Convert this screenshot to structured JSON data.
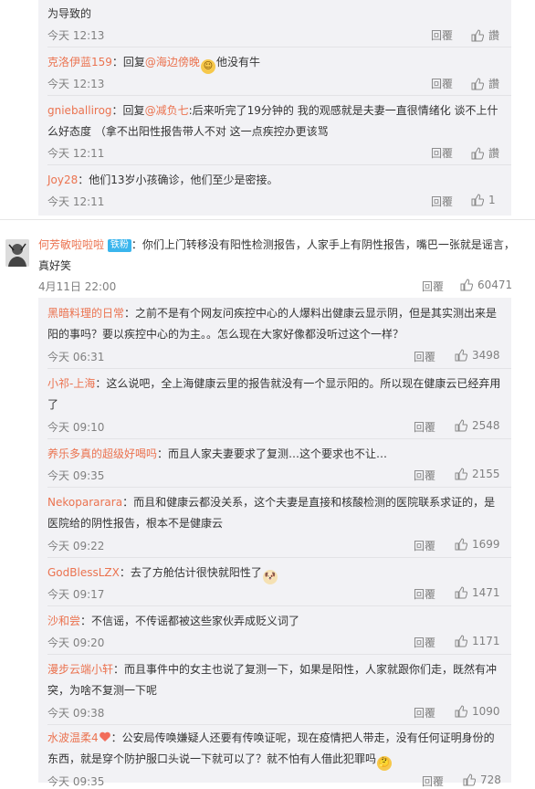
{
  "top_thread": [
    {
      "text_cont": "为导致的",
      "time": "今天 12:13",
      "reply": "回覆",
      "like": "讚"
    },
    {
      "user": "克洛伊蓝159",
      "colon": "：回复",
      "mention": "@海边傍晚",
      "emoji": "smiling-face-emoji",
      "text": "他没有牛",
      "time": "今天 12:13",
      "reply": "回覆",
      "like": "讚"
    },
    {
      "user": "gnieballirog",
      "colon": "：回复",
      "mention": "@减负七",
      "text": ":后来听完了19分钟的 我的观感就是夫妻一直很情绪化 谈不上什么好态度 （拿不出阳性报告带人不对 这一点疾控办更该骂",
      "time": "今天 12:11",
      "reply": "回覆",
      "like": "讚"
    },
    {
      "user": "Joy28",
      "text": "：他们13岁小孩确诊，他们至少是密接。",
      "time": "今天 12:11",
      "reply": "回覆",
      "like": "1"
    }
  ],
  "main_comment": {
    "user": "何芳敏啦啦啦",
    "badge": "铁粉",
    "text": "：你们上门转移没有阳性检测报告，人家手上有阴性报告，嘴巴一张就是谣言，真好笑",
    "time": "4月11日 22:00",
    "reply": "回覆",
    "like": "60471"
  },
  "replies": [
    {
      "user": "黑暗料理的日常",
      "text": "：之前不是有个网友问疾控中心的人爆料出健康云显示阴，但是其实测出来是阳的事吗？要以疾控中心的为主。。怎么现在大家好像都没听过这个一样？",
      "time": "今天 06:31",
      "reply": "回覆",
      "like": "3498"
    },
    {
      "user": "小祁-上海",
      "text": "：这么说吧，全上海健康云里的报告就没有一个显示阳的。所以现在健康云已经弃用了",
      "time": "今天 09:10",
      "reply": "回覆",
      "like": "2548"
    },
    {
      "user": "养乐多真的超级好喝吗",
      "text": "：而且人家夫妻要求了复测…这个要求也不让…",
      "time": "今天 09:35",
      "reply": "回覆",
      "like": "2155"
    },
    {
      "user": "Nekopararara",
      "text": "：而且和健康云都没关系，这个夫妻是直接和核酸检测的医院联系求证的，是医院给的阴性报告，根本不是健康云",
      "time": "今天 09:22",
      "reply": "回覆",
      "like": "1699"
    },
    {
      "user": "GodBlessLZX",
      "text": "：去了方舱估计很快就阳性了",
      "emoji": "dog-emoji",
      "time": "今天 09:17",
      "reply": "回覆",
      "like": "1471"
    },
    {
      "user": "沙和尝",
      "text": "：不信谣，不传谣都被这些家伙弄成贬义词了",
      "time": "今天 09:20",
      "reply": "回覆",
      "like": "1171"
    },
    {
      "user": "漫步云端小轩",
      "text": "：而且事件中的女主也说了复测一下，如果是阳性，人家就跟你们走，既然有冲突，为啥不复测一下呢",
      "time": "今天 09:38",
      "reply": "回覆",
      "like": "1090"
    },
    {
      "user": "水波温柔4",
      "text": "：公安局传唤嫌疑人还要有传唤证呢，现在疫情把人带走，没有任何证明身份的东西，就是穿个防护服口头说一下就可以了？就不怕有人借此犯罪吗",
      "emoji": "thinking-emoji",
      "time": "今天 09:35",
      "reply": "回覆",
      "like": "728"
    }
  ]
}
